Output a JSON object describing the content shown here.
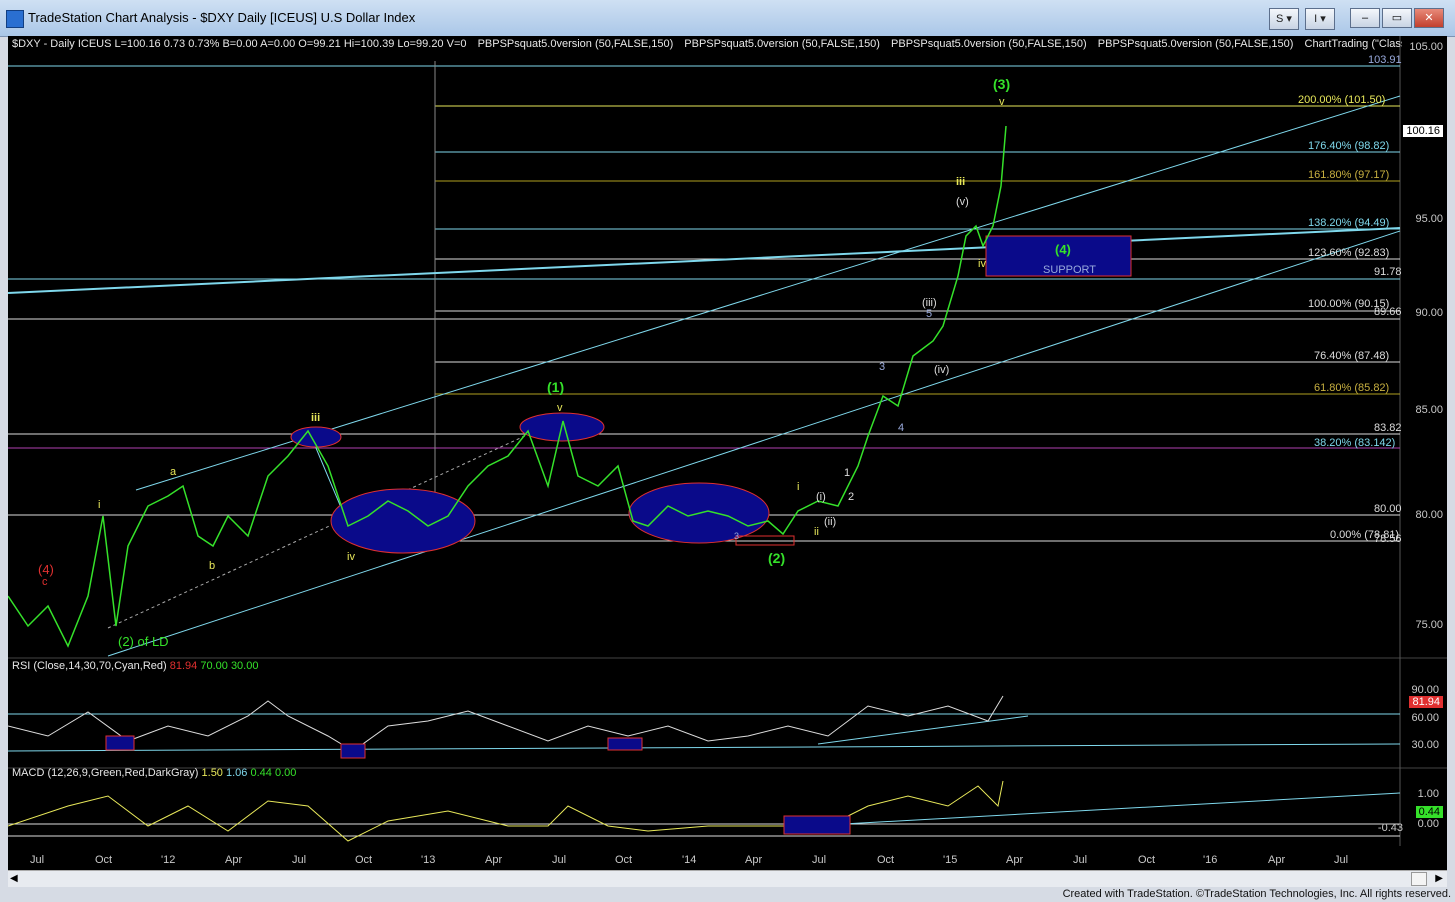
{
  "window": {
    "title": "TradeStation Chart Analysis - $DXY Daily [ICEUS] U.S Dollar Index",
    "btn_s": "S ▾",
    "btn_i": "I ▾"
  },
  "header": {
    "items": [
      "$DXY - Daily ICEUS L=100.16 0.73 0.73% B=0.00 A=0.00 O=99.21 Hi=100.39 Lo=99.20 V=0",
      "PBPSPsquat5.0version (50,FALSE,150)",
      "PBPSPsquat5.0version (50,FALSE,150)",
      "PBPSPsquat5.0version (50,FALSE,150)",
      "PBPSPsquat5.0version (50,FALSE,150)",
      "ChartTrading (\"Classic\",Tr..."
    ]
  },
  "price_axis": [
    "105.00",
    "100.16",
    "95.00",
    "90.00",
    "85.00",
    "80.00",
    "75.00"
  ],
  "levels": {
    "top": "103.91",
    "l9178": "91.78",
    "l8966": "89.66",
    "l8382": "83.82",
    "l80": "80.00",
    "l7856": "78.56"
  },
  "fib": [
    "200.00% (101.50)",
    "176.40% (98.82)",
    "161.80% (97.17)",
    "138.20% (94.49)",
    "123.60% (92.83)",
    "100.00% (90.15)",
    "76.40% (87.48)",
    "61.80% (85.82)",
    "38.20% (83.142)",
    "0.00% (78.81)"
  ],
  "labels": {
    "w3": "(3)",
    "v_top": "v",
    "iii_top": "iii",
    "v_paren": "(v)",
    "w4": "(4)",
    "support": "SUPPORT",
    "iv_small": "iv",
    "iii_paren": "(iii)",
    "five": "5",
    "three": "3",
    "iv_paren": "(iv)",
    "four": "4",
    "one": "1",
    "two": "2",
    "i_small": "i",
    "i_paren": "(i)",
    "ii_paren": "(ii)",
    "ii_small": "ii",
    "w1": "(1)",
    "v_mid": "v",
    "w2": "(2)",
    "three_small": "3",
    "iii_left": "iii",
    "a_left": "a",
    "b_left": "b",
    "i_left": "i",
    "iv_left": "iv",
    "w4_red": "(4)",
    "c_red": "c",
    "two_ld": "(2) of LD"
  },
  "rsi": {
    "title": "RSI (Close,14,30,70,Cyan,Red)",
    "v1": "81.94",
    "v2": "70.00",
    "v3": "30.00",
    "axis": [
      "90.00",
      "81.94",
      "60.00",
      "30.00"
    ]
  },
  "macd": {
    "title": "MACD (12,26,9,Green,Red,DarkGray)",
    "v1": "1.50",
    "v2": "1.06",
    "v3": "0.44",
    "v4": "0.00",
    "axis": [
      "1.00",
      "0.44",
      "0.00",
      "-0.43"
    ]
  },
  "dates": [
    "Jul",
    "Oct",
    "'12",
    "Apr",
    "Jul",
    "Oct",
    "'13",
    "Apr",
    "Jul",
    "Oct",
    "'14",
    "Apr",
    "Jul",
    "Oct",
    "'15",
    "Apr",
    "Jul",
    "Oct",
    "'16",
    "Apr",
    "Jul"
  ],
  "footer": "Created with TradeStation. ©TradeStation Technologies, Inc. All rights reserved.",
  "colors": {
    "bg": "#000000",
    "price": "#35e12a",
    "cyan": "#7fd8ec",
    "yellow": "#e8e85a",
    "magenta": "#b040b0",
    "blue_fill": "#0a0a8a",
    "red": "#e03030"
  }
}
